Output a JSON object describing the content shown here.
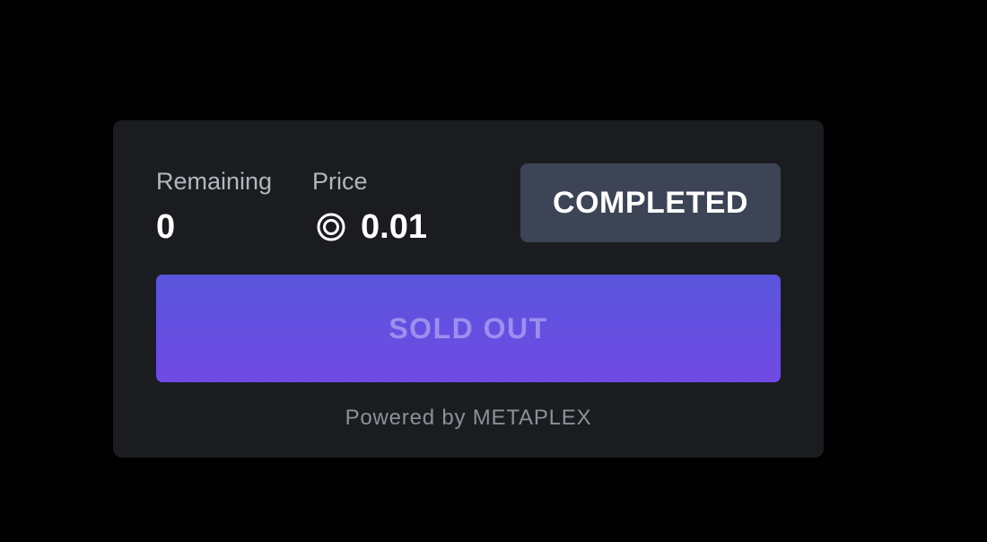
{
  "card": {
    "remaining": {
      "label": "Remaining",
      "value": "0"
    },
    "price": {
      "label": "Price",
      "icon": "solana-circle-icon",
      "value": "0.01"
    },
    "status_badge": "COMPLETED",
    "action_button": "SOLD OUT",
    "footer_text": "Powered by METAPLEX"
  },
  "colors": {
    "page_background": "#000000",
    "card_background": "#1a1c20",
    "badge_background": "#3c4456",
    "button_gradient_start": "#5956dc",
    "button_gradient_end": "#7049e4",
    "button_text": "#9d8ef0"
  }
}
